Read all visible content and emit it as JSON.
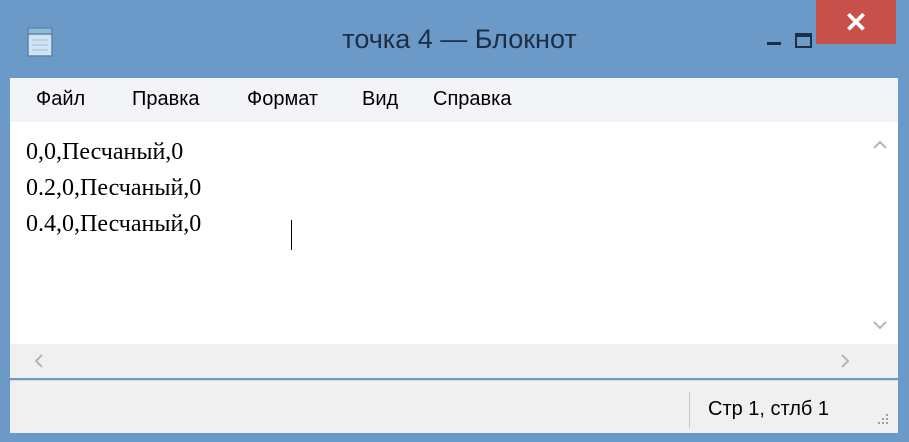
{
  "window": {
    "title": "точка 4 — Блокнот",
    "accent_color": "#6b9ac9",
    "close_color": "#c7504a",
    "icons": [
      "notepad-icon",
      "minimize-icon",
      "maximize-icon",
      "close-icon"
    ]
  },
  "menu": {
    "items": [
      "Файл",
      "Правка",
      "Формат",
      "Вид",
      "Справка"
    ]
  },
  "editor": {
    "lines": [
      "0,0,Песчаный,0",
      "0.2,0,Песчаный,0",
      "0.4,0,Песчаный,0"
    ]
  },
  "status": {
    "position": "Стр 1, стлб 1"
  }
}
